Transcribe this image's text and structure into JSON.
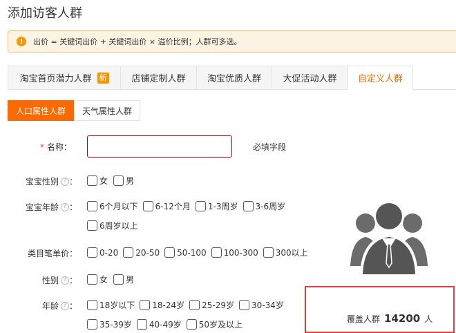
{
  "page": {
    "title": "添加访客人群"
  },
  "notice": {
    "text": "出价 = 关键词出价 + 关键词出价 × 溢价比例；人群可多选。"
  },
  "tabs": [
    {
      "label": "淘宝首页潜力人群",
      "badge": "新"
    },
    {
      "label": "店铺定制人群"
    },
    {
      "label": "淘宝优质人群"
    },
    {
      "label": "大促活动人群"
    },
    {
      "label": "自定义人群"
    }
  ],
  "active_tab": "自定义人群",
  "subtabs": [
    {
      "label": "人口属性人群"
    },
    {
      "label": "天气属性人群"
    }
  ],
  "active_subtab": "人口属性人群",
  "form": {
    "name": {
      "required_mark": "*",
      "label": "名称：",
      "value": "",
      "hint": "必填字段"
    },
    "baby_gender": {
      "label": "宝宝性别",
      "colon": "：",
      "options": [
        "女",
        "男"
      ]
    },
    "baby_age": {
      "label": "宝宝年龄",
      "colon": "：",
      "options": [
        "6个月以下",
        "6-12个月",
        "1-3周岁",
        "3-6周岁",
        "6周岁以上"
      ]
    },
    "category_price": {
      "label": "类目笔单价：",
      "options": [
        "0-20",
        "20-50",
        "50-100",
        "100-300",
        "300以上"
      ]
    },
    "gender": {
      "label": "性别",
      "colon": "：",
      "options": [
        "女",
        "男"
      ]
    },
    "age": {
      "label": "年龄",
      "colon": "：",
      "options": [
        "18岁以下",
        "18-24岁",
        "25-29岁",
        "30-34岁",
        "35-39岁",
        "40-49岁",
        "50岁及以上"
      ]
    }
  },
  "help_icon": "?",
  "coverage": {
    "label": "覆盖人群",
    "value": "14200",
    "unit": "人"
  },
  "icons": {
    "notice": "warning-icon",
    "help": "question-icon",
    "illustration": "people-group-icon"
  },
  "colors": {
    "accent": "#ff6a00",
    "badge": "#f39800",
    "highlight_border": "#e23d3d"
  }
}
